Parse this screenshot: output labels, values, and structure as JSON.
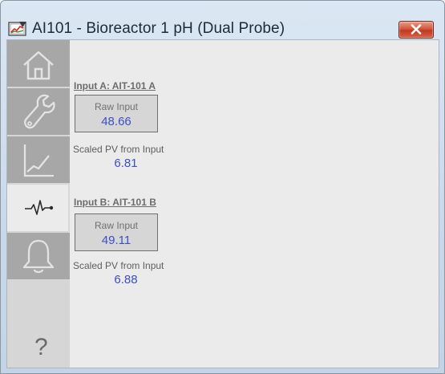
{
  "window": {
    "title": "AI101 - Bioreactor 1 pH (Dual Probe)"
  },
  "sidebar": {
    "items": [
      {
        "icon": "home-icon",
        "active": false
      },
      {
        "icon": "wrench-icon",
        "active": false
      },
      {
        "icon": "trend-icon",
        "active": false
      },
      {
        "icon": "waveform-icon",
        "active": true
      },
      {
        "icon": "bell-icon",
        "active": false
      },
      {
        "icon": "help-icon",
        "active": false
      }
    ],
    "help_glyph": "?"
  },
  "inputs": [
    {
      "header": "Input A: AIT-101 A",
      "raw_label": "Raw Input",
      "raw_value": "48.66",
      "scaled_label": "Scaled PV from Input",
      "scaled_value": "6.81"
    },
    {
      "header": "Input B: AIT-101 B",
      "raw_label": "Raw Input",
      "raw_value": "49.11",
      "scaled_label": "Scaled PV from Input",
      "scaled_value": "6.88"
    }
  ],
  "colors": {
    "value_text": "#3c50c0",
    "nav_button": "#a7a7a7",
    "close_button": "#c7412a"
  }
}
